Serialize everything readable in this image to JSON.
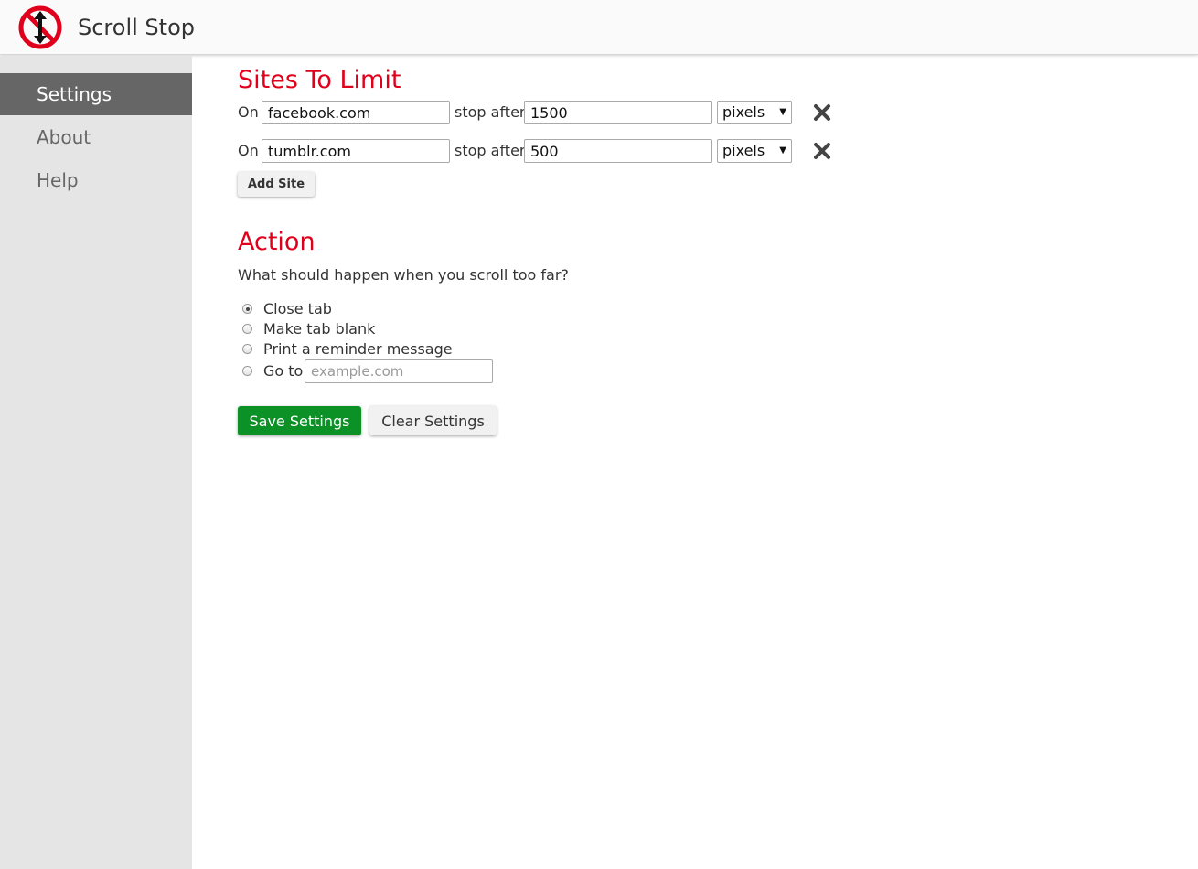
{
  "app": {
    "title": "Scroll Stop",
    "logo_icon": "no-scroll-logo-icon"
  },
  "sidebar": {
    "items": [
      {
        "label": "Settings",
        "active": true
      },
      {
        "label": "About",
        "active": false
      },
      {
        "label": "Help",
        "active": false
      }
    ]
  },
  "sites_section": {
    "title": "Sites To Limit",
    "on_label": "On",
    "stop_after_label": "stop after",
    "remove_icon": "close-x-icon",
    "rows": [
      {
        "site": "facebook.com",
        "amount": "1500",
        "unit": "pixels"
      },
      {
        "site": "tumblr.com",
        "amount": "500",
        "unit": "pixels"
      }
    ],
    "add_button_label": "Add Site"
  },
  "action_section": {
    "title": "Action",
    "question": "What should happen when you scroll too far?",
    "options": [
      {
        "label": "Close tab",
        "checked": true
      },
      {
        "label": "Make tab blank",
        "checked": false
      },
      {
        "label": "Print a reminder message",
        "checked": false
      },
      {
        "label": "Go to",
        "checked": false
      }
    ],
    "goto_placeholder": "example.com",
    "goto_value": ""
  },
  "buttons": {
    "save_label": "Save Settings",
    "clear_label": "Clear Settings"
  },
  "colors": {
    "accent_red": "#e0001b",
    "save_green": "#0c9126",
    "sidebar_bg": "#e5e5e5",
    "sidebar_active_bg": "#666666"
  }
}
